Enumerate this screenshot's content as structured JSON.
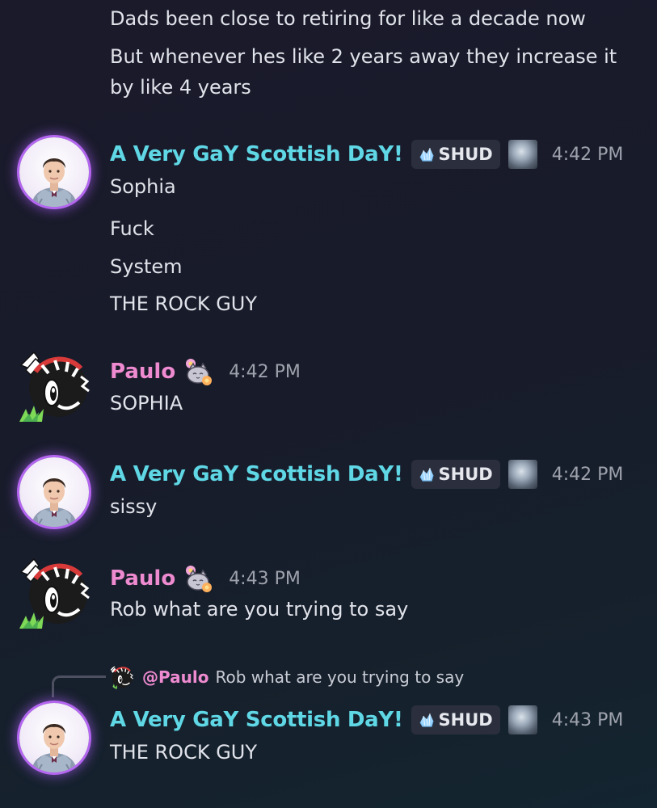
{
  "messages": [
    {
      "continuation": true,
      "lines": [
        "Dads been close to retiring for like a decade now",
        "But whenever hes like 2 years away they increase it by like 4 years"
      ]
    },
    {
      "author": "A Very GaY Scottish DaY!",
      "tag": "SHUD",
      "timestamp": "4:42 PM",
      "lines": [
        "Sophia",
        "Fuck",
        "System",
        "THE ROCK GUY"
      ]
    },
    {
      "author": "Paulo",
      "timestamp": "4:42 PM",
      "lines": [
        "SOPHIA"
      ]
    },
    {
      "author": "A Very GaY Scottish DaY!",
      "tag": "SHUD",
      "timestamp": "4:42 PM",
      "lines": [
        "sissy"
      ]
    },
    {
      "author": "Paulo",
      "timestamp": "4:43 PM",
      "lines": [
        "Rob what are you trying to say"
      ]
    },
    {
      "reply": {
        "mention": "@Paulo",
        "text": "Rob what are you trying to say"
      },
      "author": "A Very GaY Scottish DaY!",
      "tag": "SHUD",
      "timestamp": "4:43 PM",
      "lines": [
        "THE ROCK GUY"
      ]
    }
  ],
  "colors": {
    "scot_name": "#5fd7e5",
    "paulo_name": "#ee8ad0",
    "timestamp": "#9ea2ad",
    "tag_bg": "#2b2f3d"
  },
  "icons": {
    "tag": "crystal-icon",
    "role": "wolf-role-icon",
    "paulo_emote": "cat-flower-emote-icon"
  }
}
